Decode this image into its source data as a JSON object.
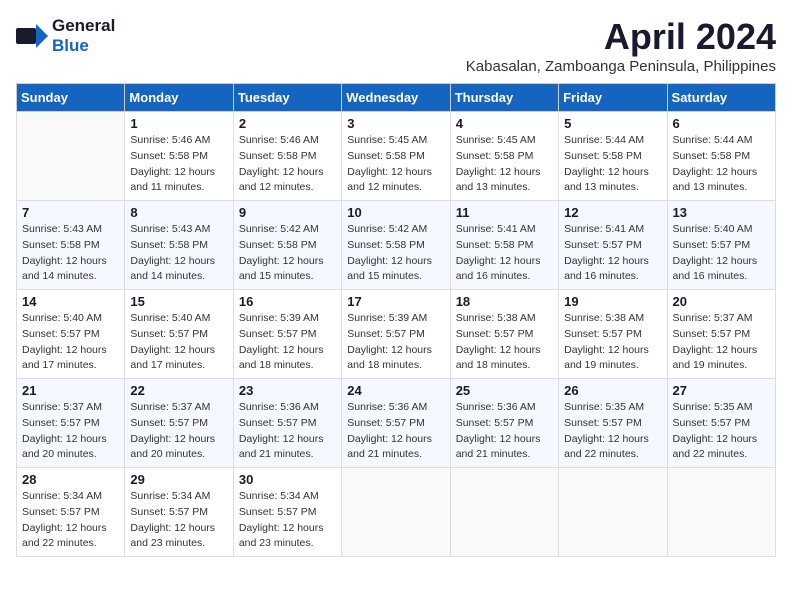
{
  "logo": {
    "general": "General",
    "blue": "Blue"
  },
  "title": "April 2024",
  "subtitle": "Kabasalan, Zamboanga Peninsula, Philippines",
  "headers": [
    "Sunday",
    "Monday",
    "Tuesday",
    "Wednesday",
    "Thursday",
    "Friday",
    "Saturday"
  ],
  "weeks": [
    [
      {
        "num": "",
        "sunrise": "",
        "sunset": "",
        "daylight": ""
      },
      {
        "num": "1",
        "sunrise": "Sunrise: 5:46 AM",
        "sunset": "Sunset: 5:58 PM",
        "daylight": "Daylight: 12 hours and 11 minutes."
      },
      {
        "num": "2",
        "sunrise": "Sunrise: 5:46 AM",
        "sunset": "Sunset: 5:58 PM",
        "daylight": "Daylight: 12 hours and 12 minutes."
      },
      {
        "num": "3",
        "sunrise": "Sunrise: 5:45 AM",
        "sunset": "Sunset: 5:58 PM",
        "daylight": "Daylight: 12 hours and 12 minutes."
      },
      {
        "num": "4",
        "sunrise": "Sunrise: 5:45 AM",
        "sunset": "Sunset: 5:58 PM",
        "daylight": "Daylight: 12 hours and 13 minutes."
      },
      {
        "num": "5",
        "sunrise": "Sunrise: 5:44 AM",
        "sunset": "Sunset: 5:58 PM",
        "daylight": "Daylight: 12 hours and 13 minutes."
      },
      {
        "num": "6",
        "sunrise": "Sunrise: 5:44 AM",
        "sunset": "Sunset: 5:58 PM",
        "daylight": "Daylight: 12 hours and 13 minutes."
      }
    ],
    [
      {
        "num": "7",
        "sunrise": "Sunrise: 5:43 AM",
        "sunset": "Sunset: 5:58 PM",
        "daylight": "Daylight: 12 hours and 14 minutes."
      },
      {
        "num": "8",
        "sunrise": "Sunrise: 5:43 AM",
        "sunset": "Sunset: 5:58 PM",
        "daylight": "Daylight: 12 hours and 14 minutes."
      },
      {
        "num": "9",
        "sunrise": "Sunrise: 5:42 AM",
        "sunset": "Sunset: 5:58 PM",
        "daylight": "Daylight: 12 hours and 15 minutes."
      },
      {
        "num": "10",
        "sunrise": "Sunrise: 5:42 AM",
        "sunset": "Sunset: 5:58 PM",
        "daylight": "Daylight: 12 hours and 15 minutes."
      },
      {
        "num": "11",
        "sunrise": "Sunrise: 5:41 AM",
        "sunset": "Sunset: 5:58 PM",
        "daylight": "Daylight: 12 hours and 16 minutes."
      },
      {
        "num": "12",
        "sunrise": "Sunrise: 5:41 AM",
        "sunset": "Sunset: 5:57 PM",
        "daylight": "Daylight: 12 hours and 16 minutes."
      },
      {
        "num": "13",
        "sunrise": "Sunrise: 5:40 AM",
        "sunset": "Sunset: 5:57 PM",
        "daylight": "Daylight: 12 hours and 16 minutes."
      }
    ],
    [
      {
        "num": "14",
        "sunrise": "Sunrise: 5:40 AM",
        "sunset": "Sunset: 5:57 PM",
        "daylight": "Daylight: 12 hours and 17 minutes."
      },
      {
        "num": "15",
        "sunrise": "Sunrise: 5:40 AM",
        "sunset": "Sunset: 5:57 PM",
        "daylight": "Daylight: 12 hours and 17 minutes."
      },
      {
        "num": "16",
        "sunrise": "Sunrise: 5:39 AM",
        "sunset": "Sunset: 5:57 PM",
        "daylight": "Daylight: 12 hours and 18 minutes."
      },
      {
        "num": "17",
        "sunrise": "Sunrise: 5:39 AM",
        "sunset": "Sunset: 5:57 PM",
        "daylight": "Daylight: 12 hours and 18 minutes."
      },
      {
        "num": "18",
        "sunrise": "Sunrise: 5:38 AM",
        "sunset": "Sunset: 5:57 PM",
        "daylight": "Daylight: 12 hours and 18 minutes."
      },
      {
        "num": "19",
        "sunrise": "Sunrise: 5:38 AM",
        "sunset": "Sunset: 5:57 PM",
        "daylight": "Daylight: 12 hours and 19 minutes."
      },
      {
        "num": "20",
        "sunrise": "Sunrise: 5:37 AM",
        "sunset": "Sunset: 5:57 PM",
        "daylight": "Daylight: 12 hours and 19 minutes."
      }
    ],
    [
      {
        "num": "21",
        "sunrise": "Sunrise: 5:37 AM",
        "sunset": "Sunset: 5:57 PM",
        "daylight": "Daylight: 12 hours and 20 minutes."
      },
      {
        "num": "22",
        "sunrise": "Sunrise: 5:37 AM",
        "sunset": "Sunset: 5:57 PM",
        "daylight": "Daylight: 12 hours and 20 minutes."
      },
      {
        "num": "23",
        "sunrise": "Sunrise: 5:36 AM",
        "sunset": "Sunset: 5:57 PM",
        "daylight": "Daylight: 12 hours and 21 minutes."
      },
      {
        "num": "24",
        "sunrise": "Sunrise: 5:36 AM",
        "sunset": "Sunset: 5:57 PM",
        "daylight": "Daylight: 12 hours and 21 minutes."
      },
      {
        "num": "25",
        "sunrise": "Sunrise: 5:36 AM",
        "sunset": "Sunset: 5:57 PM",
        "daylight": "Daylight: 12 hours and 21 minutes."
      },
      {
        "num": "26",
        "sunrise": "Sunrise: 5:35 AM",
        "sunset": "Sunset: 5:57 PM",
        "daylight": "Daylight: 12 hours and 22 minutes."
      },
      {
        "num": "27",
        "sunrise": "Sunrise: 5:35 AM",
        "sunset": "Sunset: 5:57 PM",
        "daylight": "Daylight: 12 hours and 22 minutes."
      }
    ],
    [
      {
        "num": "28",
        "sunrise": "Sunrise: 5:34 AM",
        "sunset": "Sunset: 5:57 PM",
        "daylight": "Daylight: 12 hours and 22 minutes."
      },
      {
        "num": "29",
        "sunrise": "Sunrise: 5:34 AM",
        "sunset": "Sunset: 5:57 PM",
        "daylight": "Daylight: 12 hours and 23 minutes."
      },
      {
        "num": "30",
        "sunrise": "Sunrise: 5:34 AM",
        "sunset": "Sunset: 5:57 PM",
        "daylight": "Daylight: 12 hours and 23 minutes."
      },
      {
        "num": "",
        "sunrise": "",
        "sunset": "",
        "daylight": ""
      },
      {
        "num": "",
        "sunrise": "",
        "sunset": "",
        "daylight": ""
      },
      {
        "num": "",
        "sunrise": "",
        "sunset": "",
        "daylight": ""
      },
      {
        "num": "",
        "sunrise": "",
        "sunset": "",
        "daylight": ""
      }
    ]
  ]
}
